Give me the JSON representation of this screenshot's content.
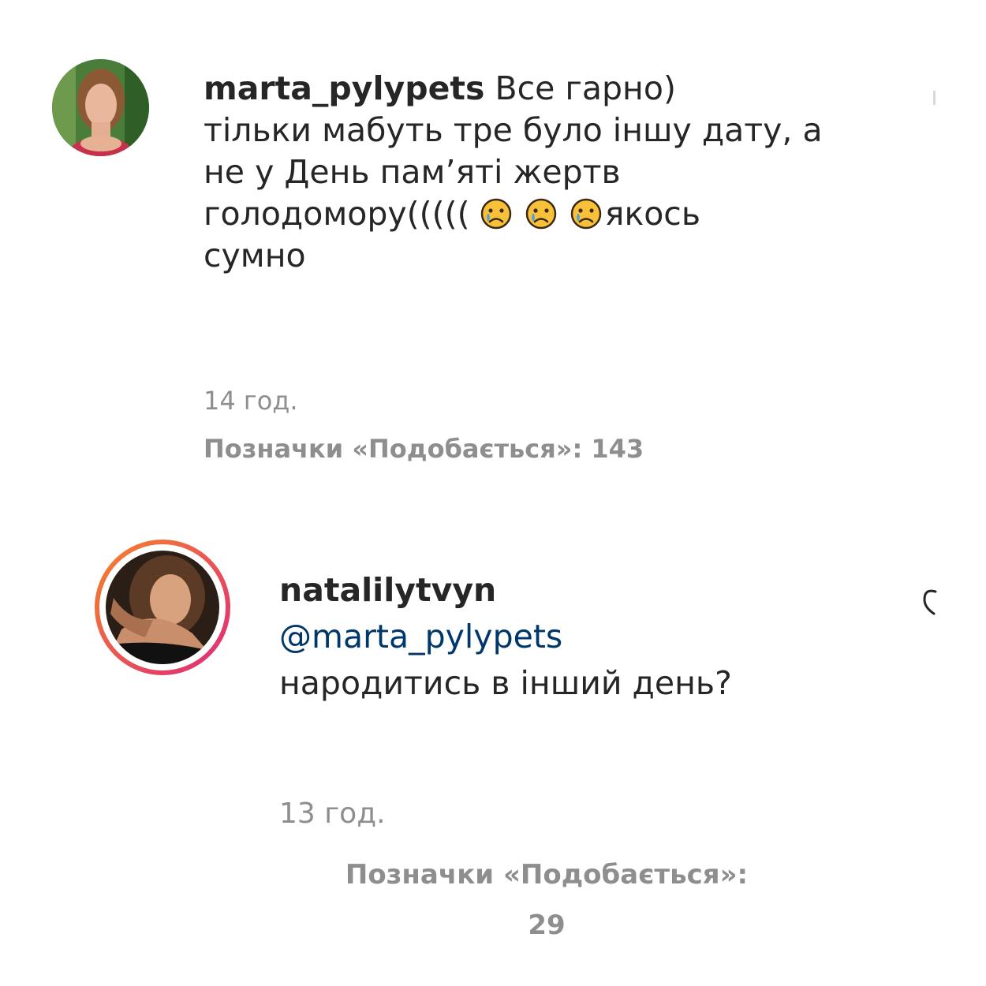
{
  "comments": [
    {
      "username": "marta_pylypets",
      "first_line": "Все гарно)",
      "lines": [
        "тільки мабуть тре було іншу дату, а",
        "не у День пам’яті жертв"
      ],
      "line_with_emoji_prefix": "голодомору(((((",
      "line_with_emoji_suffix": "якось",
      "last_line": "сумно",
      "emoji": [
        "crying-face-emoji",
        "crying-face-emoji",
        "crying-face-emoji"
      ],
      "time": "14 год.",
      "likes_label": "Позначки «Подобається»: 143"
    },
    {
      "username": "natalilytvyn",
      "mention": "@marta_pylypets",
      "text": "народитись в інший день?",
      "time": "13 год.",
      "likes_label_line1": "Позначки «Подобається»:",
      "likes_label_line2": "29"
    }
  ],
  "colors": {
    "text": "#262626",
    "meta": "#8e8e8e",
    "mention": "#00376b",
    "story_ring_start": "#f58529",
    "story_ring_end": "#dd2a7b"
  }
}
